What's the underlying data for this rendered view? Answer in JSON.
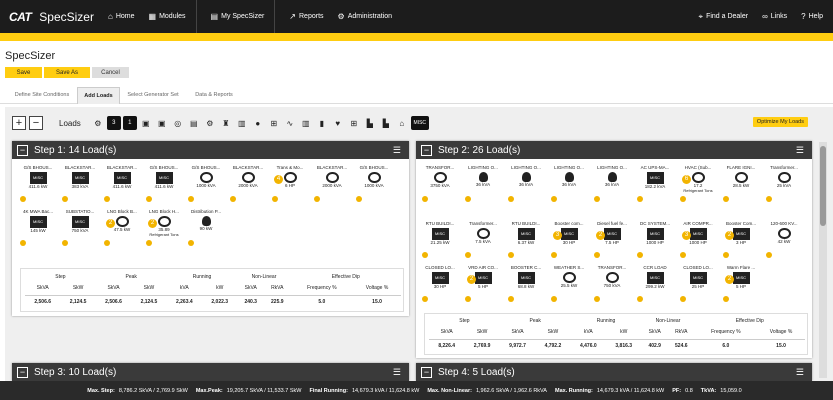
{
  "nav": {
    "brand": "CAT",
    "app_title": "SpecSizer",
    "items": [
      {
        "label": "Home",
        "icon": "home-icon"
      },
      {
        "label": "Modules",
        "icon": "grid-icon"
      },
      {
        "label": "My SpecSizer",
        "icon": "document-icon"
      },
      {
        "label": "Reports",
        "icon": "trend-icon"
      },
      {
        "label": "Administration",
        "icon": "gear-icon"
      }
    ],
    "right": [
      {
        "label": "Find a Dealer",
        "icon": "location-pin-icon"
      },
      {
        "label": "Links",
        "icon": "link-icon"
      },
      {
        "label": "Help",
        "icon": "help-icon"
      }
    ]
  },
  "page_title": "SpecSizer",
  "actions": {
    "save": "Save",
    "save_as": "Save As",
    "cancel": "Cancel"
  },
  "tabs": [
    "Define Site Conditions",
    "Add Loads",
    "Select Generator Set",
    "Data & Reports"
  ],
  "toolbar": {
    "loads_label": "Loads",
    "optimize": "Optimize My Loads",
    "icons": [
      "motor-icon",
      "3-icon",
      "1-icon",
      "ups-icon",
      "ups2-icon",
      "mri-icon",
      "xray-icon",
      "gear2-icon",
      "hydrant-icon",
      "rectifier-icon",
      "bulb-icon",
      "ac-icon",
      "wave-icon",
      "welder-icon",
      "charger-icon",
      "heart-icon",
      "hvac-icon",
      "building-icon",
      "building2-icon",
      "house-icon",
      "misc-icon"
    ]
  },
  "steps": [
    {
      "title": "Step 1: 14 Load(s)",
      "loads": [
        {
          "name": "G/S BHOUS...",
          "kind": "misc",
          "value": "411.6 kW"
        },
        {
          "name": "BLACKSTAR...",
          "kind": "misc",
          "value": "383 kVA"
        },
        {
          "name": "BLACKSTAR...",
          "kind": "misc",
          "value": "411.6 kW"
        },
        {
          "name": "G/S BHOUS...",
          "kind": "misc",
          "value": "411.6 kW"
        },
        {
          "name": "G/S BHOUS...",
          "kind": "motor",
          "value": "1000 kVA"
        },
        {
          "name": "BLACKSTAR...",
          "kind": "motor",
          "value": "2000 kVA"
        },
        {
          "name": "Trans & Mo...",
          "kind": "motor",
          "value": "6 HP",
          "count": "4"
        },
        {
          "name": "BLACKSTAR...",
          "kind": "motor",
          "value": "2000 kVA"
        },
        {
          "name": "G/S BHOUS...",
          "kind": "motor",
          "value": "1000 kVA"
        },
        {
          "name": "4K MWA Bac...",
          "kind": "misc",
          "value": "145 kW"
        },
        {
          "name": "SUBSTATIO...",
          "kind": "misc",
          "value": "750 kVA"
        },
        {
          "name": "LNG Block B...",
          "kind": "motor",
          "value": "47.5 kW",
          "count": "2"
        },
        {
          "name": "LNG Block H...",
          "kind": "motor",
          "value": "35.89",
          "sub": "Refrigerant Tons",
          "count": "2"
        },
        {
          "name": "Distribution P...",
          "kind": "bulb",
          "value": "90 kW"
        }
      ],
      "stats": {
        "groups": [
          "Step",
          "Peak",
          "Running",
          "Non-Linear",
          "Effective Dip"
        ],
        "cols": [
          "SkVA",
          "SkW",
          "SkVA",
          "SkW",
          "kVA",
          "kW",
          "SkVA",
          "RkVA",
          "Frequency %",
          "Voltage %"
        ],
        "vals": [
          "2,506.6",
          "2,124.5",
          "2,506.6",
          "2,124.5",
          "2,263.4",
          "2,022.3",
          "240.3",
          "225.9",
          "5.0",
          "15.0"
        ]
      }
    },
    {
      "title": "Step 2: 26 Load(s)",
      "loads": [
        {
          "name": "TRANSFOR...",
          "kind": "motor",
          "value": "3750 kVA"
        },
        {
          "name": "LIGHTING O...",
          "kind": "bulb",
          "value": "36 kVA"
        },
        {
          "name": "LIGHTING O...",
          "kind": "bulb",
          "value": "36 kVA"
        },
        {
          "name": "LIGHTING O...",
          "kind": "bulb",
          "value": "36 kVA"
        },
        {
          "name": "LIGHTING O...",
          "kind": "bulb",
          "value": "36 kVA"
        },
        {
          "name": "AC UPS-MA...",
          "kind": "misc",
          "value": "182.2 kVA"
        },
        {
          "name": "HVAC (Sub...",
          "kind": "motor",
          "value": "17.2",
          "sub": "Refrigerant Tons",
          "count": "6"
        },
        {
          "name": "FLARE IGNI...",
          "kind": "motor",
          "value": "28.5 kW"
        },
        {
          "name": "Transformer...",
          "kind": "motor",
          "value": "25 kVA"
        },
        {
          "name": "RTU BUILDI...",
          "kind": "misc",
          "value": "21.25 kW"
        },
        {
          "name": "Transformer...",
          "kind": "motor",
          "value": "7.5 kVA"
        },
        {
          "name": "RTU BUILDI...",
          "kind": "misc",
          "value": "6.37 kW"
        },
        {
          "name": "Booster com...",
          "kind": "misc",
          "value": "30 HP",
          "count": "3"
        },
        {
          "name": "Diesel fuel fe...",
          "kind": "misc",
          "value": "7.5 HP",
          "count": "2"
        },
        {
          "name": "DC SYSTEM...",
          "kind": "misc",
          "value": "1000 HP"
        },
        {
          "name": "AIR COMPR...",
          "kind": "misc",
          "value": "1000 HP",
          "count": "3"
        },
        {
          "name": "Booster Com...",
          "kind": "misc",
          "value": "3 HP",
          "count": "2"
        },
        {
          "name": "120-600 KV...",
          "kind": "motor",
          "value": "42 kW"
        },
        {
          "name": "CLOSED LO...",
          "kind": "misc",
          "value": "30 HP"
        },
        {
          "name": "VRD AIR CO...",
          "kind": "misc",
          "value": "5 HP",
          "count": "2"
        },
        {
          "name": "BOOSTER C...",
          "kind": "misc",
          "value": "68.8 kW"
        },
        {
          "name": "WEATHER S...",
          "kind": "motor",
          "value": "25.5 kW"
        },
        {
          "name": "TRANSFOR...",
          "kind": "motor",
          "value": "750 kVA"
        },
        {
          "name": "CCR LOAD",
          "kind": "misc",
          "value": "299.2 kW"
        },
        {
          "name": "CLOSED LO...",
          "kind": "misc",
          "value": "25 HP"
        },
        {
          "name": "Warm Flare ...",
          "kind": "misc",
          "value": "5 HP",
          "count": "2"
        }
      ],
      "stats": {
        "groups": [
          "Step",
          "Peak",
          "Running",
          "Non-Linear",
          "Effective Dip"
        ],
        "cols": [
          "SkVA",
          "SkW",
          "SkVA",
          "SkW",
          "kVA",
          "kW",
          "SkVA",
          "RkVA",
          "Frequency %",
          "Voltage %"
        ],
        "vals": [
          "8,226.4",
          "2,769.9",
          "9,972.7",
          "4,792.2",
          "4,476.0",
          "3,816.3",
          "402.9",
          "524.6",
          "6.0",
          "15.0"
        ]
      }
    },
    {
      "title": "Step 3: 10 Load(s)"
    },
    {
      "title": "Step 4: 5 Load(s)"
    }
  ],
  "summary": [
    {
      "label": "Max. Step:",
      "value": "8,786.2 SkVA / 2,769.9 SkW"
    },
    {
      "label": "Max.Peak:",
      "value": "19,205.7 SkVA / 11,533.7 SkW"
    },
    {
      "label": "Final Running:",
      "value": "14,679.3 kVA / 11,624.8 kW"
    },
    {
      "label": "Max. Non-Linear:",
      "value": "1,962.6 SkVA / 1,962.6 RkVA"
    },
    {
      "label": "Max. Running:",
      "value": "14,679.3 kVA / 11,624.8 kW"
    },
    {
      "label": "PF:",
      "value": "0.8"
    },
    {
      "label": "TkVA:",
      "value": "15,059.0"
    }
  ]
}
